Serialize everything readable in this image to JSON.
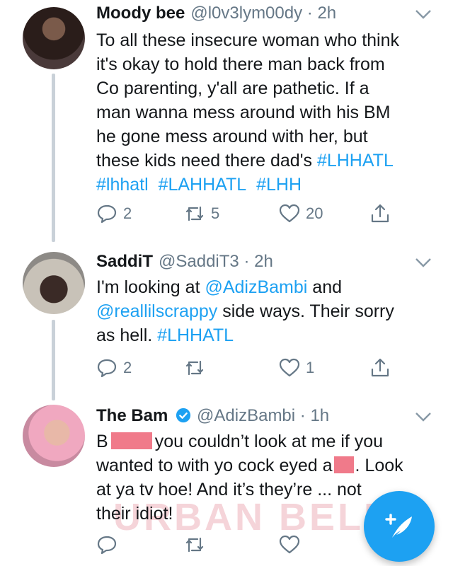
{
  "tweets": [
    {
      "name": "Moody bee",
      "handle": "@l0v3lym00dy",
      "dot": "·",
      "time": "2h",
      "text_lines": [
        "To all these insecure woman who think",
        "it's okay to hold there man back from",
        "Co parenting, y'all are pathetic. If a",
        "man wanna mess around with his BM",
        "he gone mess around with her, but"
      ],
      "text_last_prefix": "these kids need there dad's ",
      "hashtags": [
        "#LHHATL",
        "#lhhatl",
        "#LAHHATL",
        "#LHH"
      ],
      "replies": "2",
      "retweets": "5",
      "likes": "20"
    },
    {
      "name": "SaddiT",
      "handle": "@SaddiT3",
      "dot": "·",
      "time": "2h",
      "line1_prefix": "I'm looking at ",
      "mention1": "@AdizBambi",
      "line1_suffix": " and",
      "mention2": "@reallilscrappy",
      "line2_suffix": " side ways. Their sorry",
      "line3_prefix": "as hell. ",
      "hashtag": "#LHHATL",
      "replies": "2",
      "retweets": "",
      "likes": "1"
    },
    {
      "name": "The Bam",
      "handle": "@AdizBambi",
      "dot": "·",
      "time": "1h",
      "line1_a": "B",
      "line1_b": "you couldn’t look at me if you",
      "line2_a": "wanted to with yo cock eyed a",
      "line2_b": ". Look",
      "line3": "at ya tv hoe! And it’s they’re ... not",
      "line4": "their idiot!",
      "replies": "",
      "retweets": "",
      "likes": ""
    }
  ],
  "watermark": "URBAN BELLE",
  "colors": {
    "accent": "#1da1f2",
    "muted": "#657786",
    "redaction": "#f07a8a"
  },
  "icons": [
    "reply-icon",
    "retweet-icon",
    "like-icon",
    "share-icon",
    "chevron-down-icon",
    "verified-badge-icon",
    "compose-tweet-icon"
  ]
}
